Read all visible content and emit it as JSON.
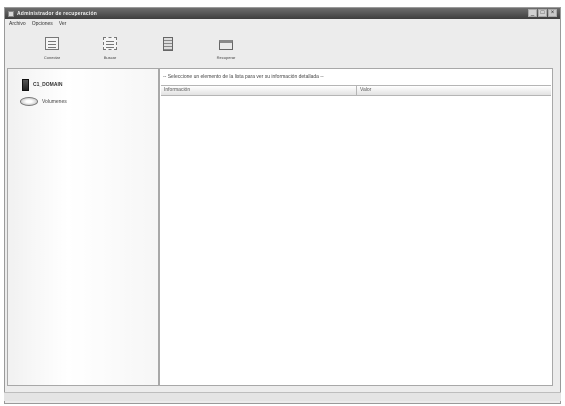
{
  "window": {
    "title": "Administrador de recuperación"
  },
  "window_buttons": {
    "minimize": "_",
    "maximize": "□",
    "close": "×"
  },
  "menu": [
    "Archivo",
    "Opciones",
    "Ver"
  ],
  "toolbar": [
    {
      "label": "Conectar",
      "icon": "connect-icon"
    },
    {
      "label": "Buscar",
      "icon": "search-document-icon"
    },
    {
      "label": "",
      "icon": "server-icon"
    },
    {
      "label": "Recuperar",
      "icon": "recover-icon"
    }
  ],
  "tree": {
    "computer": "C1_DOMAIN",
    "drive": "Volumenes"
  },
  "content": {
    "info": "-- Seleccione un elemento de la lista para ver su información detallada --",
    "columns": [
      "Información",
      "Valor"
    ]
  }
}
